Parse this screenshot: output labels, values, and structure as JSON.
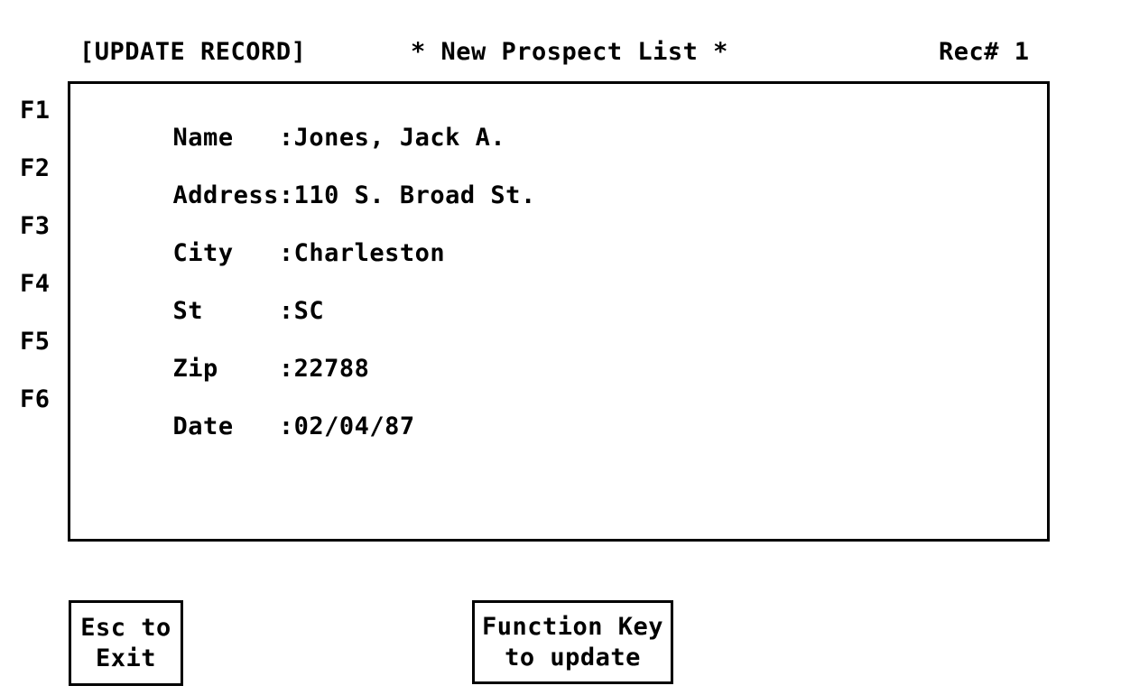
{
  "header": {
    "mode": "[UPDATE RECORD]",
    "title": "* New Prospect List *",
    "record": "Rec# 1"
  },
  "form": {
    "fields": [
      {
        "fkey": "F1",
        "label": "Name   ",
        "colon": ":",
        "value": "Jones, Jack A."
      },
      {
        "fkey": "F2",
        "label": "Address",
        "colon": ":",
        "value": "110 S. Broad St."
      },
      {
        "fkey": "F3",
        "label": "City   ",
        "colon": ":",
        "value": "Charleston"
      },
      {
        "fkey": "F4",
        "label": "St     ",
        "colon": ":",
        "value": "SC"
      },
      {
        "fkey": "F5",
        "label": "Zip    ",
        "colon": ":",
        "value": "22788"
      },
      {
        "fkey": "F6",
        "label": "Date   ",
        "colon": ":",
        "value": "02/04/87"
      }
    ]
  },
  "actions": {
    "exit": {
      "line1": "Esc to",
      "line2": "Exit"
    },
    "update": {
      "line1": "Function Key",
      "line2": "to update"
    }
  },
  "colors": {
    "background": "#ffffff",
    "foreground": "#000000"
  }
}
